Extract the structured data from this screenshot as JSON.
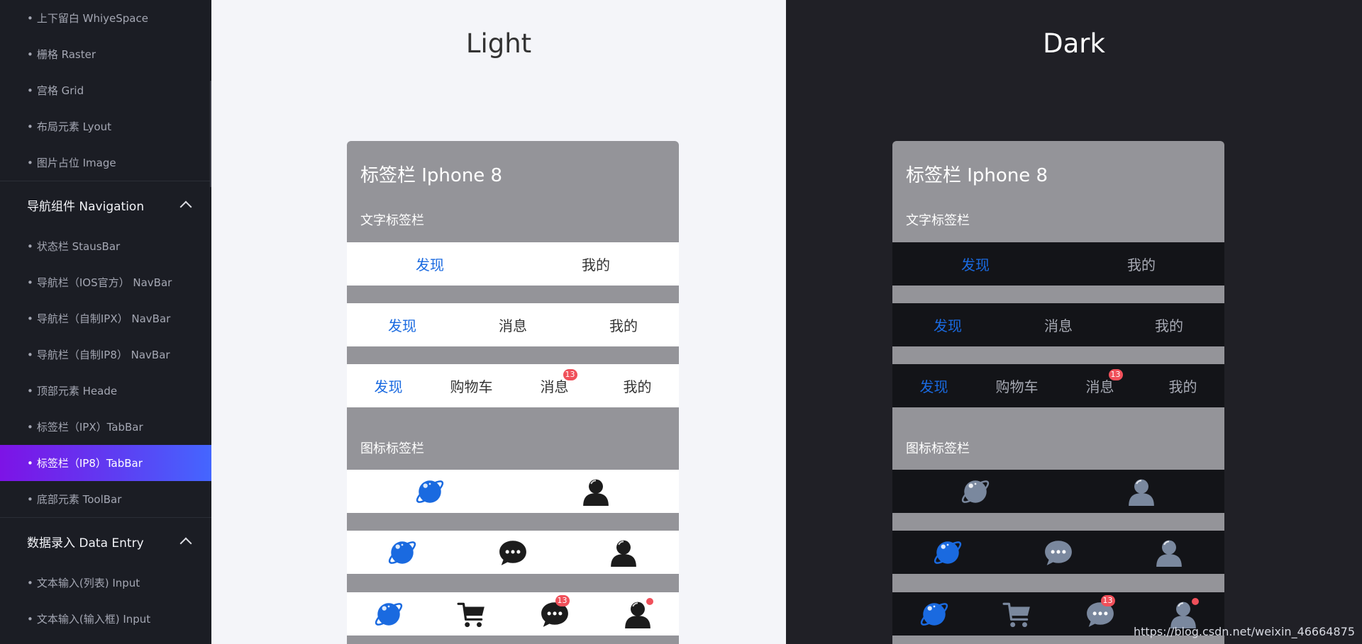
{
  "sidebar": {
    "items_top": [
      {
        "label": "上下留白 WhiyeSpace"
      },
      {
        "label": "栅格 Raster"
      },
      {
        "label": "宫格 Grid"
      },
      {
        "label": "布局元素 Lyout"
      },
      {
        "label": "图片占位 Image"
      }
    ],
    "group_nav": "导航组件 Navigation",
    "items_nav": [
      {
        "label": "状态栏 StausBar"
      },
      {
        "label": "导航栏（IOS官方） NavBar"
      },
      {
        "label": "导航栏（自制IPX） NavBar"
      },
      {
        "label": "导航栏（自制IP8） NavBar"
      },
      {
        "label": "顶部元素 Heade"
      },
      {
        "label": "标签栏（IPX）TabBar"
      },
      {
        "label": "标签栏（IP8）TabBar"
      },
      {
        "label": "底部元素 ToolBar"
      }
    ],
    "active_index": 6,
    "group_entry": "数据录入 Data Entry",
    "items_entry": [
      {
        "label": "文本输入(列表) Input"
      },
      {
        "label": "文本输入(输入框) Input"
      }
    ]
  },
  "panels": {
    "light_title": "Light",
    "dark_title": "Dark"
  },
  "phone": {
    "title": "标签栏  Iphone 8",
    "section_text": "文字标签栏",
    "section_icon": "图标标签栏",
    "text_bars": [
      [
        "发现",
        "我的"
      ],
      [
        "发现",
        "消息",
        "我的"
      ],
      [
        "发现",
        "购物车",
        "消息",
        "我的"
      ]
    ],
    "message_badge": "13",
    "icons": {
      "discover": "planet-icon",
      "mine": "user-icon",
      "message": "chat-bubble-icon",
      "cart": "cart-icon"
    }
  },
  "colors": {
    "accent": "#1a6ae0",
    "badge": "#f0505a",
    "sidebar_active_start": "#7d13e6",
    "sidebar_active_end": "#4466ff",
    "phone_header": "#949499",
    "dark_icon": "#7a889e"
  },
  "watermark": "https://blog.csdn.net/weixin_46664875"
}
